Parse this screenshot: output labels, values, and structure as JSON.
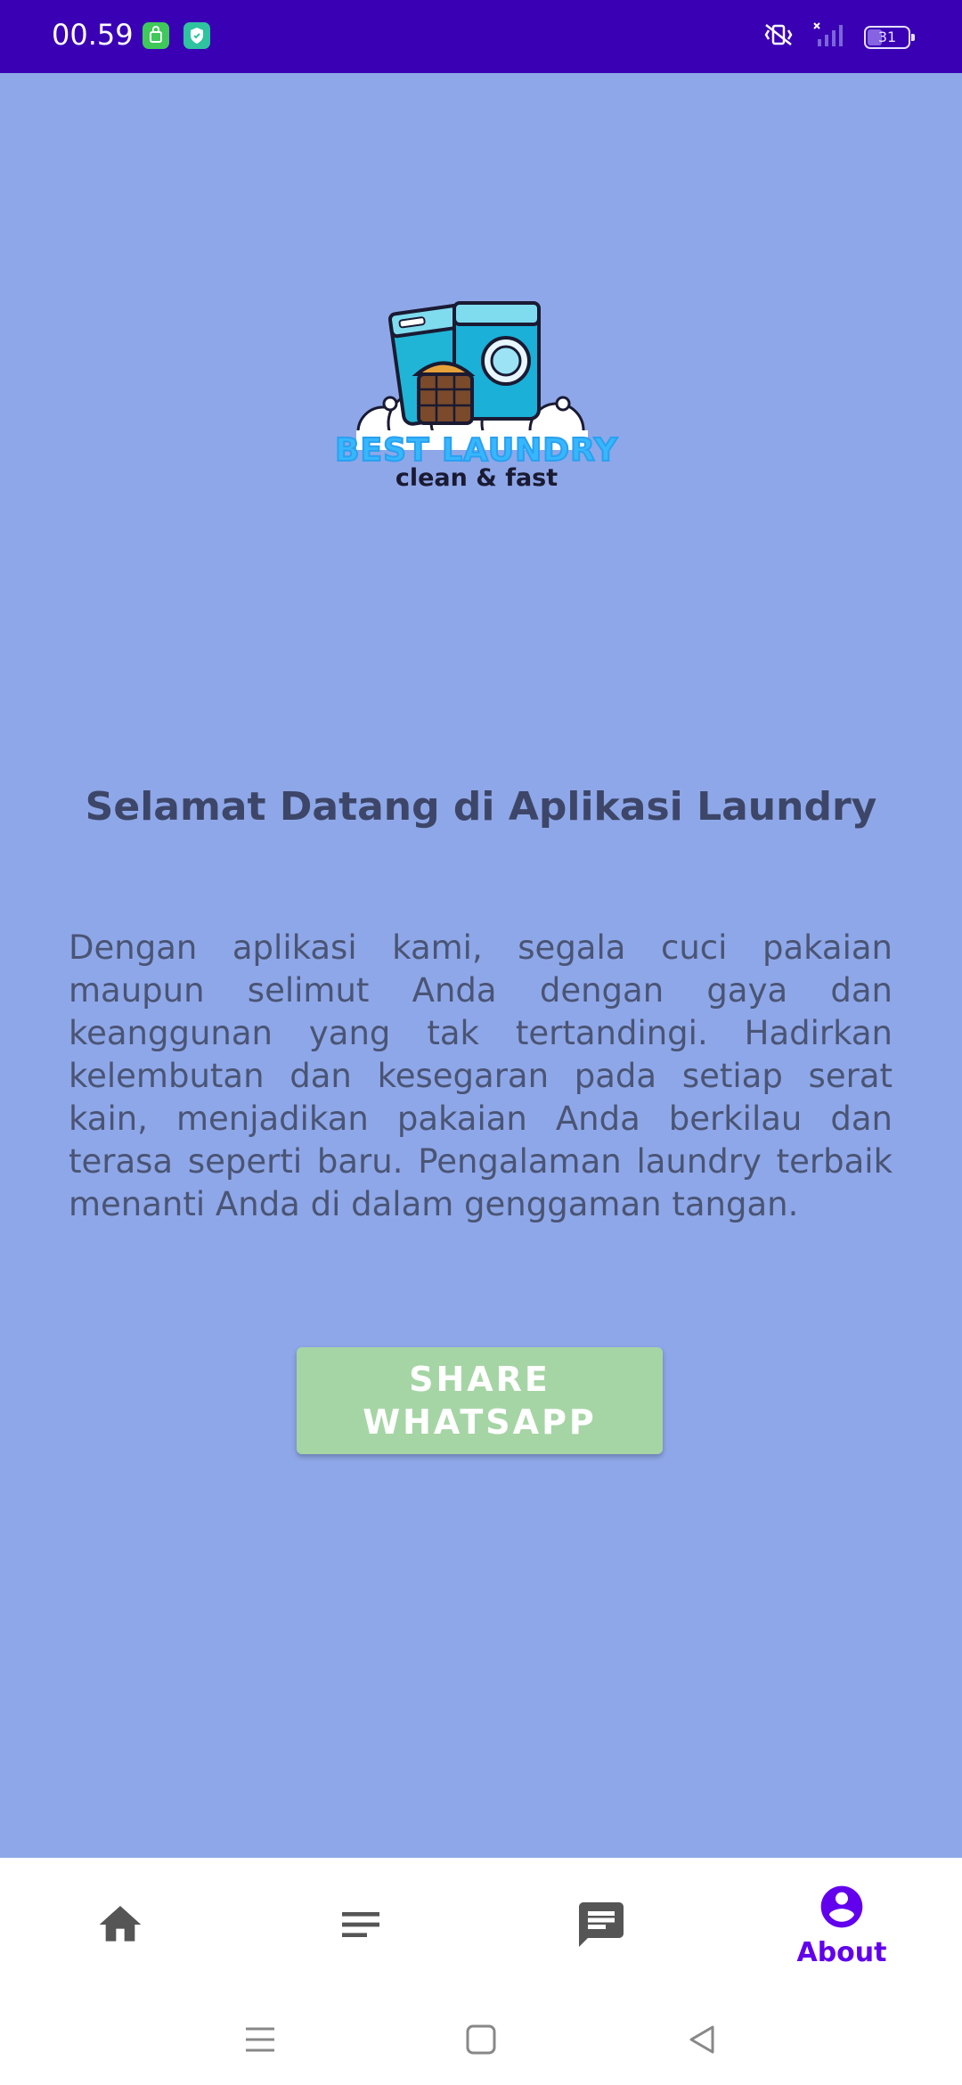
{
  "status_bar": {
    "time": "00.59",
    "battery_level": "31",
    "colors": {
      "background": "#3a00b4"
    }
  },
  "logo": {
    "title": "BEST LAUNDRY",
    "subtitle": "clean & fast"
  },
  "main": {
    "welcome_title": "Selamat Datang di Aplikasi Laundry",
    "description": "Dengan aplikasi kami, segala cuci pakaian maupun selimut Anda dengan gaya dan keanggunan yang tak tertandingi. Hadirkan kelembutan dan kesegaran pada setiap serat kain, menjadikan pakaian Anda berkilau dan terasa seperti baru. Pengalaman laundry terbaik menanti Anda di dalam genggaman tangan.",
    "share_button_label": "SHARE WHATSAPP",
    "colors": {
      "background": "#8ea7e8",
      "button": "#a6d5a5",
      "text": "#4a5474"
    }
  },
  "bottom_nav": {
    "items": [
      {
        "icon": "home-icon",
        "label": "",
        "active": false
      },
      {
        "icon": "list-icon",
        "label": "",
        "active": false
      },
      {
        "icon": "chat-icon",
        "label": "",
        "active": false
      },
      {
        "icon": "account-icon",
        "label": "About",
        "active": true
      }
    ],
    "colors": {
      "active": "#6200ee",
      "inactive": "#555555"
    }
  },
  "system_nav": {
    "buttons": [
      "menu-icon",
      "home-square-icon",
      "back-icon"
    ]
  }
}
